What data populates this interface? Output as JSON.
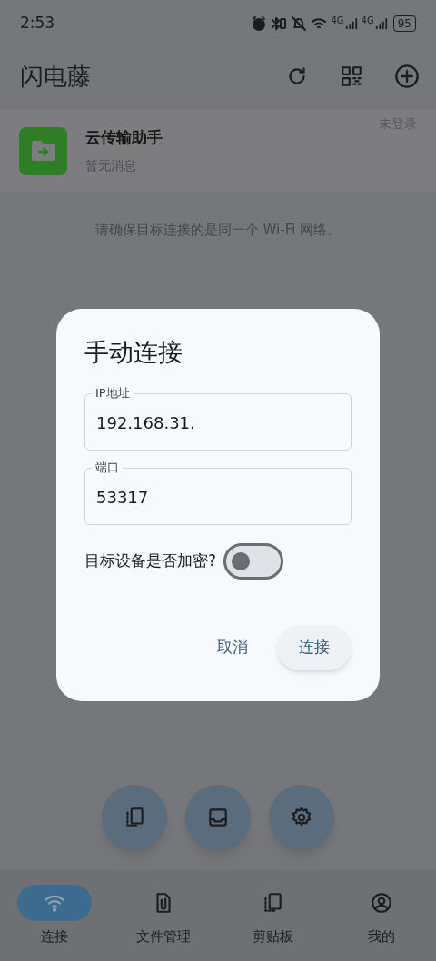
{
  "status_bar": {
    "time": "2:53",
    "signals": [
      "4G",
      "4G"
    ],
    "battery": "95"
  },
  "header": {
    "title": "闪电藤"
  },
  "device": {
    "name": "云传输助手",
    "message": "暂无消息",
    "status": "未登录"
  },
  "hint": "请确保目标连接的是同一个 Wi-Fi 网络。",
  "dialog": {
    "title": "手动连接",
    "fields": [
      {
        "label": "IP地址",
        "value": "192.168.31."
      },
      {
        "label": "端口",
        "value": "53317"
      }
    ],
    "toggle": {
      "label": "目标设备是否加密?",
      "on": false
    },
    "buttons": [
      {
        "label": "取消",
        "kind": "text"
      },
      {
        "label": "连接",
        "kind": "tonal"
      }
    ]
  },
  "nav": [
    {
      "label": "连接",
      "kind": "wifi",
      "selected": true
    },
    {
      "label": "文件管理",
      "kind": "file",
      "selected": false
    },
    {
      "label": "剪贴板",
      "kind": "clipboard",
      "selected": false
    },
    {
      "label": "我的",
      "kind": "user",
      "selected": false
    }
  ]
}
